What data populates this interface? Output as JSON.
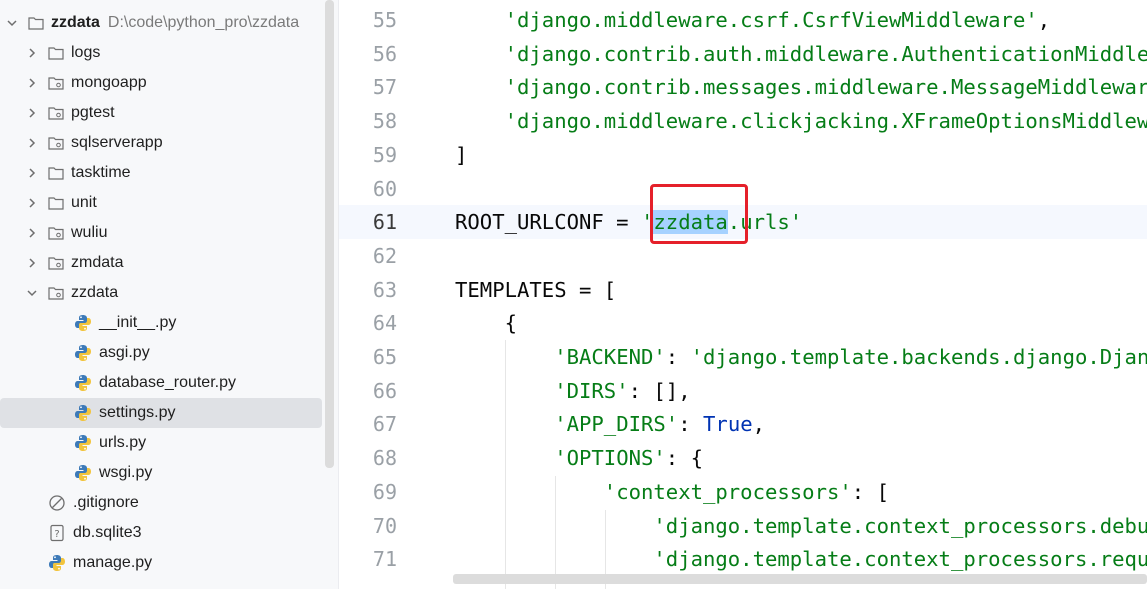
{
  "project_tree": {
    "root": {
      "name": "zzdata",
      "path": "D:\\code\\python_pro\\zzdata"
    },
    "items": [
      {
        "label": "logs",
        "kind": "folder",
        "expanded": false
      },
      {
        "label": "mongoapp",
        "kind": "module",
        "expanded": false
      },
      {
        "label": "pgtest",
        "kind": "module",
        "expanded": false
      },
      {
        "label": "sqlserverapp",
        "kind": "module",
        "expanded": false
      },
      {
        "label": "tasktime",
        "kind": "folder",
        "expanded": false
      },
      {
        "label": "unit",
        "kind": "folder",
        "expanded": false
      },
      {
        "label": "wuliu",
        "kind": "module",
        "expanded": false
      },
      {
        "label": "zmdata",
        "kind": "module",
        "expanded": false
      },
      {
        "label": "zzdata",
        "kind": "module",
        "expanded": true
      },
      {
        "label": "__init__.py",
        "kind": "python-file"
      },
      {
        "label": "asgi.py",
        "kind": "python-file"
      },
      {
        "label": "database_router.py",
        "kind": "python-file"
      },
      {
        "label": "settings.py",
        "kind": "python-file",
        "selected": true
      },
      {
        "label": "urls.py",
        "kind": "python-file"
      },
      {
        "label": "wsgi.py",
        "kind": "python-file"
      },
      {
        "label": ".gitignore",
        "kind": "ignored-file"
      },
      {
        "label": "db.sqlite3",
        "kind": "unknown-file"
      },
      {
        "label": "manage.py",
        "kind": "python-file"
      }
    ]
  },
  "editor": {
    "line_numbers": [
      "55",
      "56",
      "57",
      "58",
      "59",
      "60",
      "61",
      "62",
      "63",
      "64",
      "65",
      "66",
      "67",
      "68",
      "69",
      "70",
      "71"
    ],
    "current_line": "61",
    "lines": [
      {
        "indent": "    ",
        "parts": [
          {
            "t": "'django.middleware.csrf.CsrfViewMiddleware'",
            "c": "str"
          },
          {
            "t": ",",
            "c": ""
          }
        ]
      },
      {
        "indent": "    ",
        "parts": [
          {
            "t": "'django.contrib.auth.middleware.AuthenticationMiddleware'",
            "c": "str"
          },
          {
            "t": ",",
            "c": ""
          }
        ]
      },
      {
        "indent": "    ",
        "parts": [
          {
            "t": "'django.contrib.messages.middleware.MessageMiddleware'",
            "c": "str"
          },
          {
            "t": ",",
            "c": ""
          }
        ]
      },
      {
        "indent": "    ",
        "parts": [
          {
            "t": "'django.middleware.clickjacking.XFrameOptionsMiddleware'",
            "c": "str"
          },
          {
            "t": ",",
            "c": ""
          }
        ]
      },
      {
        "indent": "",
        "parts": [
          {
            "t": "]",
            "c": ""
          }
        ]
      },
      {
        "indent": "",
        "parts": []
      },
      {
        "indent": "",
        "parts": [
          {
            "t": "ROOT_URLCONF = ",
            "c": ""
          },
          {
            "t": "'",
            "c": "str"
          },
          {
            "t": "zzdata",
            "c": "str hl"
          },
          {
            "t": ".urls'",
            "c": "str"
          }
        ]
      },
      {
        "indent": "",
        "parts": []
      },
      {
        "indent": "",
        "parts": [
          {
            "t": "TEMPLATES = [",
            "c": ""
          }
        ]
      },
      {
        "indent": "    ",
        "parts": [
          {
            "t": "{",
            "c": ""
          }
        ]
      },
      {
        "indent": "        ",
        "parts": [
          {
            "t": "'BACKEND'",
            "c": "str"
          },
          {
            "t": ": ",
            "c": ""
          },
          {
            "t": "'django.template.backends.django.DjangoTemplates'",
            "c": "str"
          },
          {
            "t": ",",
            "c": ""
          }
        ]
      },
      {
        "indent": "        ",
        "parts": [
          {
            "t": "'DIRS'",
            "c": "str"
          },
          {
            "t": ": [],",
            "c": ""
          }
        ]
      },
      {
        "indent": "        ",
        "parts": [
          {
            "t": "'APP_DIRS'",
            "c": "str"
          },
          {
            "t": ": ",
            "c": ""
          },
          {
            "t": "True",
            "c": "kw"
          },
          {
            "t": ",",
            "c": ""
          }
        ]
      },
      {
        "indent": "        ",
        "parts": [
          {
            "t": "'OPTIONS'",
            "c": "str"
          },
          {
            "t": ": {",
            "c": ""
          }
        ]
      },
      {
        "indent": "            ",
        "parts": [
          {
            "t": "'context_processors'",
            "c": "str"
          },
          {
            "t": ": [",
            "c": ""
          }
        ]
      },
      {
        "indent": "                ",
        "parts": [
          {
            "t": "'django.template.context_processors.debug'",
            "c": "str"
          },
          {
            "t": ",",
            "c": ""
          }
        ]
      },
      {
        "indent": "                ",
        "parts": [
          {
            "t": "'django.template.context_processors.request'",
            "c": "str"
          },
          {
            "t": ",",
            "c": ""
          }
        ]
      }
    ],
    "annotation": "red-rectangle-around-zzdata",
    "colors": {
      "string": "#067d17",
      "keyword": "#0033b3",
      "selection": "#a6d2ff",
      "annotation": "#e5202a"
    }
  }
}
